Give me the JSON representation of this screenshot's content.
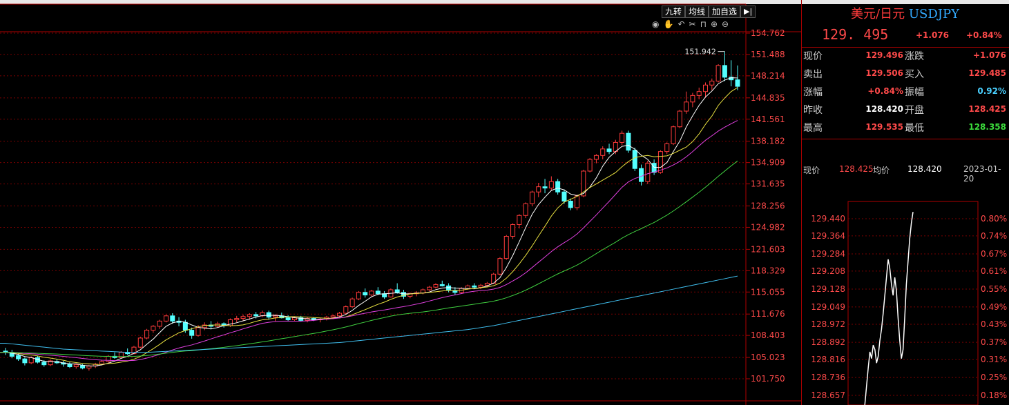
{
  "toolbar": {
    "jiuzhuan": "九转",
    "junxian": "均线",
    "jiazixuan": "加自选",
    "arrow_icon": "▶|"
  },
  "drawtools": [
    "eye-icon",
    "hand-icon",
    "undo-icon",
    "scissors-icon",
    "lock-icon",
    "zoom-in-icon",
    "zoom-out-icon"
  ],
  "quote": {
    "name": "美元/日元",
    "code": "USDJPY",
    "price": "129. 495",
    "change": "+1.076",
    "change_pct": "+0.84%",
    "rows": [
      {
        "l": "现价",
        "v": "129.496",
        "vc": "red",
        "l2": "涨跌",
        "v2": "+1.076",
        "v2c": "red"
      },
      {
        "l": "卖出",
        "v": "129.506",
        "vc": "red",
        "l2": "买入",
        "v2": "129.485",
        "v2c": "red"
      },
      {
        "l": "涨幅",
        "v": "+0.84%",
        "vc": "red",
        "l2": "振幅",
        "v2": "0.92%",
        "v2c": "cyan"
      },
      {
        "l": "昨收",
        "v": "128.420",
        "vc": "white",
        "l2": "开盘",
        "v2": "128.425",
        "v2c": "red"
      },
      {
        "l": "最高",
        "v": "129.535",
        "vc": "red",
        "l2": "最低",
        "v2": "128.358",
        "v2c": "green"
      }
    ]
  },
  "mini": {
    "xianjia_label": "现价",
    "xianjia": "128.425",
    "junjia_label": "均价",
    "junjia": "128.420",
    "date": "2023-01-20",
    "left_ticks": [
      "129.440",
      "129.364",
      "129.284",
      "129.208",
      "129.128",
      "129.049",
      "128.972",
      "128.892",
      "128.816",
      "128.736",
      "128.657"
    ],
    "right_ticks": [
      "0.80%",
      "0.74%",
      "0.67%",
      "0.61%",
      "0.55%",
      "0.49%",
      "0.43%",
      "0.37%",
      "0.31%",
      "0.25%",
      "0.18%"
    ],
    "line": [
      128.55,
      128.62,
      128.7,
      128.78,
      128.85,
      128.82,
      128.88,
      128.86,
      128.8,
      128.83,
      128.9,
      128.95,
      129.02,
      129.1,
      129.18,
      129.26,
      129.22,
      129.15,
      129.1,
      129.18,
      129.12,
      129.0,
      128.9,
      128.82,
      128.86,
      129.0,
      129.15,
      129.25,
      129.35,
      129.42,
      129.47
    ]
  },
  "chart_data": {
    "type": "candlestick",
    "y_ticks": [
      "154.762",
      "151.488",
      "148.214",
      "144.835",
      "141.561",
      "138.182",
      "134.909",
      "131.635",
      "128.256",
      "124.982",
      "121.603",
      "118.329",
      "115.055",
      "111.676",
      "108.403",
      "105.023",
      "101.750"
    ],
    "ylim": [
      100.0,
      156.3
    ],
    "annotation": "151.942",
    "candles": [
      [
        106.0,
        106.5,
        105.4,
        105.8
      ],
      [
        105.8,
        106.2,
        104.9,
        105.2
      ],
      [
        105.3,
        105.6,
        104.5,
        104.8
      ],
      [
        104.8,
        105.0,
        103.8,
        104.2
      ],
      [
        104.2,
        105.2,
        104.0,
        105.0
      ],
      [
        105.0,
        105.3,
        104.1,
        104.3
      ],
      [
        104.3,
        104.6,
        103.6,
        103.9
      ],
      [
        103.9,
        104.7,
        103.7,
        104.5
      ],
      [
        104.4,
        104.8,
        104.0,
        104.2
      ],
      [
        104.2,
        104.5,
        103.6,
        104.0
      ],
      [
        104.0,
        104.3,
        103.4,
        103.6
      ],
      [
        103.6,
        104.1,
        103.3,
        103.9
      ],
      [
        103.8,
        104.0,
        103.2,
        103.4
      ],
      [
        103.4,
        103.9,
        103.0,
        103.7
      ],
      [
        103.7,
        104.2,
        103.4,
        104.0
      ],
      [
        104.0,
        104.6,
        103.8,
        104.4
      ],
      [
        104.4,
        105.4,
        104.2,
        105.2
      ],
      [
        105.2,
        105.8,
        104.8,
        105.0
      ],
      [
        105.0,
        106.0,
        104.9,
        105.8
      ],
      [
        105.8,
        106.4,
        105.4,
        105.6
      ],
      [
        105.6,
        106.8,
        105.5,
        106.6
      ],
      [
        106.6,
        108.2,
        106.4,
        108.0
      ],
      [
        108.0,
        109.4,
        107.8,
        109.2
      ],
      [
        109.2,
        110.0,
        108.8,
        109.8
      ],
      [
        109.8,
        110.8,
        109.4,
        110.6
      ],
      [
        110.6,
        111.6,
        110.4,
        111.4
      ],
      [
        111.4,
        111.8,
        110.2,
        110.6
      ],
      [
        110.6,
        111.2,
        109.8,
        110.4
      ],
      [
        110.4,
        110.8,
        108.8,
        109.2
      ],
      [
        109.2,
        109.6,
        107.9,
        108.4
      ],
      [
        108.4,
        110.0,
        108.2,
        109.6
      ],
      [
        109.6,
        110.4,
        109.2,
        110.0
      ],
      [
        110.0,
        110.6,
        109.4,
        109.8
      ],
      [
        109.8,
        110.5,
        109.6,
        110.2
      ],
      [
        110.2,
        110.4,
        109.6,
        109.9
      ],
      [
        109.9,
        111.0,
        109.7,
        110.8
      ],
      [
        110.8,
        111.4,
        110.4,
        111.0
      ],
      [
        111.0,
        111.6,
        110.6,
        111.3
      ],
      [
        111.3,
        111.8,
        110.8,
        111.6
      ],
      [
        111.6,
        112.0,
        111.0,
        111.4
      ],
      [
        111.4,
        112.2,
        111.2,
        111.9
      ],
      [
        111.9,
        112.2,
        110.8,
        111.2
      ],
      [
        111.2,
        111.6,
        110.6,
        111.4
      ],
      [
        111.4,
        111.9,
        111.0,
        111.1
      ],
      [
        111.1,
        111.5,
        110.6,
        110.8
      ],
      [
        110.8,
        111.3,
        110.6,
        111.1
      ],
      [
        111.1,
        111.4,
        110.5,
        110.7
      ],
      [
        110.7,
        111.2,
        110.4,
        111.0
      ],
      [
        111.0,
        111.2,
        110.6,
        110.8
      ],
      [
        110.8,
        111.1,
        110.4,
        110.9
      ],
      [
        110.9,
        111.4,
        110.7,
        111.2
      ],
      [
        111.2,
        111.6,
        110.9,
        111.4
      ],
      [
        111.4,
        112.0,
        111.2,
        111.8
      ],
      [
        111.8,
        113.0,
        111.6,
        112.8
      ],
      [
        112.8,
        114.2,
        112.6,
        114.0
      ],
      [
        114.0,
        115.2,
        113.8,
        115.0
      ],
      [
        115.0,
        115.6,
        114.2,
        114.6
      ],
      [
        114.6,
        115.4,
        114.4,
        115.2
      ],
      [
        115.2,
        115.8,
        114.6,
        114.8
      ],
      [
        114.8,
        115.2,
        114.0,
        114.3
      ],
      [
        114.3,
        115.6,
        114.2,
        115.4
      ],
      [
        115.4,
        116.4,
        114.8,
        115.0
      ],
      [
        115.0,
        115.4,
        114.0,
        114.4
      ],
      [
        114.4,
        115.0,
        114.1,
        114.8
      ],
      [
        114.8,
        115.2,
        114.4,
        114.9
      ],
      [
        114.9,
        115.6,
        114.7,
        115.4
      ],
      [
        115.4,
        116.0,
        115.2,
        115.8
      ],
      [
        115.8,
        116.4,
        115.6,
        116.2
      ],
      [
        116.2,
        116.8,
        115.9,
        116.0
      ],
      [
        116.0,
        116.4,
        115.0,
        115.3
      ],
      [
        115.3,
        115.8,
        114.6,
        115.0
      ],
      [
        115.0,
        115.8,
        114.8,
        115.6
      ],
      [
        115.6,
        116.2,
        115.4,
        116.0
      ],
      [
        116.0,
        116.4,
        115.6,
        115.8
      ],
      [
        115.8,
        116.3,
        115.5,
        116.1
      ],
      [
        116.1,
        116.6,
        115.8,
        116.4
      ],
      [
        116.4,
        118.0,
        116.3,
        117.8
      ],
      [
        117.8,
        120.4,
        117.6,
        120.2
      ],
      [
        120.2,
        123.8,
        120.0,
        123.6
      ],
      [
        123.6,
        125.6,
        123.2,
        125.4
      ],
      [
        125.4,
        127.0,
        124.8,
        126.8
      ],
      [
        126.8,
        128.8,
        126.4,
        128.6
      ],
      [
        128.6,
        130.6,
        128.2,
        130.4
      ],
      [
        130.4,
        131.8,
        129.6,
        131.2
      ],
      [
        131.2,
        132.4,
        130.2,
        131.0
      ],
      [
        131.0,
        132.8,
        130.6,
        132.0
      ],
      [
        132.0,
        132.4,
        130.0,
        130.4
      ],
      [
        130.4,
        130.8,
        128.6,
        129.0
      ],
      [
        129.0,
        129.4,
        127.6,
        128.0
      ],
      [
        128.0,
        130.0,
        127.6,
        129.8
      ],
      [
        129.8,
        133.8,
        129.6,
        133.6
      ],
      [
        133.6,
        135.6,
        133.4,
        135.4
      ],
      [
        135.4,
        136.2,
        134.8,
        136.0
      ],
      [
        136.0,
        137.4,
        135.4,
        137.0
      ],
      [
        137.0,
        137.8,
        136.2,
        136.6
      ],
      [
        136.6,
        138.4,
        136.2,
        138.0
      ],
      [
        138.0,
        139.8,
        137.6,
        139.4
      ],
      [
        139.4,
        139.8,
        136.4,
        136.8
      ],
      [
        136.8,
        137.2,
        133.6,
        134.0
      ],
      [
        134.0,
        134.6,
        131.4,
        132.0
      ],
      [
        132.0,
        135.2,
        131.6,
        134.8
      ],
      [
        134.8,
        135.4,
        133.0,
        133.4
      ],
      [
        133.4,
        136.8,
        133.2,
        136.6
      ],
      [
        136.6,
        138.0,
        136.2,
        137.8
      ],
      [
        137.8,
        140.6,
        137.6,
        140.4
      ],
      [
        140.4,
        143.0,
        140.2,
        142.8
      ],
      [
        142.8,
        145.8,
        142.4,
        144.2
      ],
      [
        144.2,
        145.6,
        143.4,
        145.2
      ],
      [
        145.2,
        146.4,
        144.6,
        145.8
      ],
      [
        145.8,
        147.2,
        145.0,
        146.8
      ],
      [
        146.8,
        147.8,
        146.0,
        147.4
      ],
      [
        147.4,
        150.0,
        147.2,
        149.8
      ],
      [
        149.8,
        151.94,
        147.4,
        148.0
      ],
      [
        148.0,
        150.6,
        146.6,
        147.6
      ],
      [
        147.6,
        149.8,
        146.0,
        146.6
      ]
    ],
    "ma_series": [
      {
        "color": "#ffffff",
        "period": 5
      },
      {
        "color": "#e8e040",
        "period": 10
      },
      {
        "color": "#e040e0",
        "period": 20
      },
      {
        "color": "#40d040",
        "period": 40
      },
      {
        "color": "#40c0f0",
        "period": 80,
        "extra": [
          107.2,
          107.1,
          107.0,
          106.9,
          106.8,
          106.7,
          106.6,
          106.5,
          106.4,
          106.3,
          106.25,
          106.2,
          106.15,
          106.1,
          106.05,
          106.0,
          105.95,
          105.9,
          105.85,
          105.8,
          105.8,
          105.8,
          105.8,
          105.85,
          105.9,
          105.95,
          106.0,
          106.05,
          106.1,
          106.15,
          106.2,
          106.25,
          106.3,
          106.35,
          106.4,
          106.45,
          106.5,
          106.55,
          106.6,
          106.65,
          106.7,
          106.75,
          106.8,
          106.85,
          106.9,
          106.95,
          107.0,
          107.05,
          107.1,
          107.15,
          107.2,
          107.25,
          107.3,
          107.4,
          107.5,
          107.6,
          107.7,
          107.8,
          107.9,
          108.0,
          108.1,
          108.2,
          108.3,
          108.4,
          108.5,
          108.6,
          108.7,
          108.8,
          108.9,
          109.0,
          109.1,
          109.2,
          109.3,
          109.45,
          109.6,
          109.75,
          109.9,
          110.1,
          110.3,
          110.5,
          110.7,
          110.9,
          111.1,
          111.3,
          111.5,
          111.7,
          111.9,
          112.1,
          112.3,
          112.5,
          112.7,
          112.9,
          113.1,
          113.3,
          113.5,
          113.7,
          113.9,
          114.1,
          114.3,
          114.5,
          114.7,
          114.9,
          115.1,
          115.3,
          115.5,
          115.7,
          115.9,
          116.1,
          116.3,
          116.5,
          116.7,
          116.9,
          117.1,
          117.3,
          117.5
        ]
      }
    ]
  }
}
